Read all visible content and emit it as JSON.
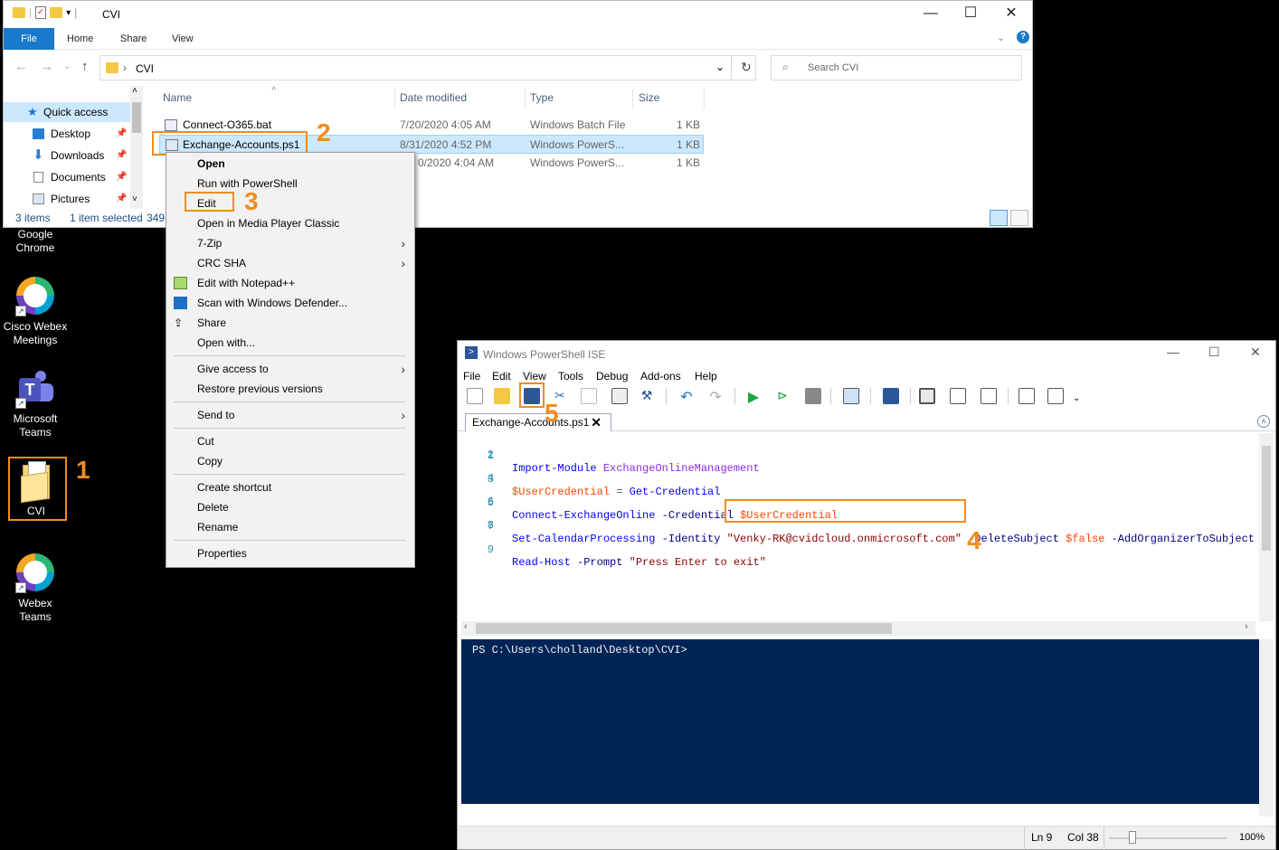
{
  "desktop": {
    "icons": [
      {
        "label_line1": "Google",
        "label_line2": "Chrome"
      },
      {
        "label_line1": "Cisco Webex",
        "label_line2": "Meetings"
      },
      {
        "label_line1": "Microsoft",
        "label_line2": "Teams"
      },
      {
        "label_line1": "CVI",
        "label_line2": ""
      },
      {
        "label_line1": "Webex",
        "label_line2": "Teams"
      }
    ]
  },
  "annotations": {
    "n1": "1",
    "n2": "2",
    "n3": "3",
    "n4": "4",
    "n5": "5",
    "accent": "#f08c1e"
  },
  "explorer": {
    "title": "CVI",
    "tabs": {
      "file": "File",
      "home": "Home",
      "share": "Share",
      "view": "View"
    },
    "address": {
      "sep": "›",
      "path": "CVI"
    },
    "search_placeholder": "Search CVI",
    "nav": {
      "quick_access": "Quick access",
      "desktop": "Desktop",
      "downloads": "Downloads",
      "documents": "Documents",
      "pictures": "Pictures"
    },
    "columns": {
      "name": "Name",
      "date": "Date modified",
      "type": "Type",
      "size": "Size"
    },
    "files": [
      {
        "name": "Connect-O365.bat",
        "date": "7/20/2020 4:05 AM",
        "type": "Windows Batch File",
        "size": "1 KB"
      },
      {
        "name": "Exchange-Accounts.ps1",
        "date": "8/31/2020 4:52 PM",
        "type": "Windows PowerS...",
        "size": "1 KB"
      },
      {
        "name": "",
        "date": "0/2020 4:04 AM",
        "type": "Windows PowerS...",
        "size": "1 KB"
      }
    ],
    "status": {
      "items": "3 items",
      "selected": "1 item selected",
      "bytes": "349"
    }
  },
  "context_menu": {
    "open": "Open",
    "run_ps": "Run with PowerShell",
    "edit": "Edit",
    "open_mpc": "Open in Media Player Classic",
    "zip": "7-Zip",
    "crc": "CRC SHA",
    "npp": "Edit with Notepad++",
    "defender": "Scan with Windows Defender...",
    "share": "Share",
    "open_with": "Open with...",
    "give_access": "Give access to",
    "restore": "Restore previous versions",
    "send_to": "Send to",
    "cut": "Cut",
    "copy": "Copy",
    "create_shortcut": "Create shortcut",
    "delete": "Delete",
    "rename": "Rename",
    "properties": "Properties"
  },
  "ise": {
    "title": "Windows PowerShell ISE",
    "menu": {
      "file": "File",
      "edit": "Edit",
      "view": "View",
      "tools": "Tools",
      "debug": "Debug",
      "addons": "Add-ons",
      "help": "Help"
    },
    "tab": "Exchange-Accounts.ps1",
    "code": {
      "l1_cmd": "Import-Module",
      "l1_arg": "ExchangeOnlineManagement",
      "l3_var": "$UserCredential",
      "l3_eq": "=",
      "l3_cmd": "Get-Credential",
      "l5_cmd": "Connect-ExchangeOnline",
      "l5_par": "-Credential",
      "l5_var": "$UserCredential",
      "l7_cmd": "Set-CalendarProcessing",
      "l7_par1": "-Identity",
      "l7_str": "\"Venky-RK@cvidcloud.onmicrosoft.com\"",
      "l7_par2": "-DeleteSubject",
      "l7_var": "$false",
      "l7_par3": "-AddOrganizerToSubject",
      "l9_cmd": "Read-Host",
      "l9_par": "-Prompt",
      "l9_str": "\"Press Enter to exit\""
    },
    "line_numbers": [
      "1",
      "2",
      "3",
      "4",
      "5",
      "6",
      "7",
      "8",
      "9"
    ],
    "console_prompt": "PS C:\\Users\\cholland\\Desktop\\CVI>",
    "status": {
      "ln": "Ln 9",
      "col": "Col 38",
      "zoom": "100%"
    }
  }
}
